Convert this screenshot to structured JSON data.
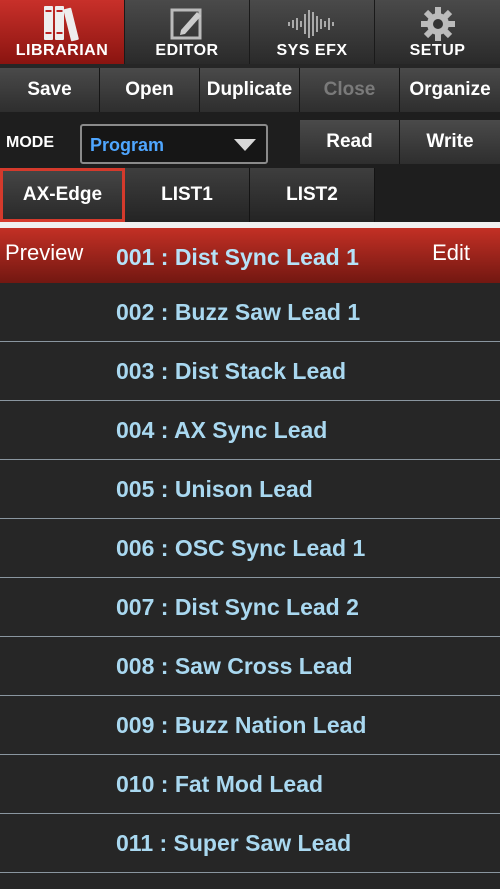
{
  "topnav": {
    "tabs": [
      {
        "label": "LIBRARIAN",
        "icon": "books-icon",
        "active": true
      },
      {
        "label": "EDITOR",
        "icon": "pencil-edit-icon",
        "active": false
      },
      {
        "label": "SYS EFX",
        "icon": "waveform-icon",
        "active": false
      },
      {
        "label": "SETUP",
        "icon": "gear-icon",
        "active": false
      }
    ]
  },
  "actions": {
    "save": "Save",
    "open": "Open",
    "duplicate": "Duplicate",
    "close": "Close",
    "organize": "Organize"
  },
  "mode": {
    "label": "MODE",
    "value": "Program",
    "read": "Read",
    "write": "Write"
  },
  "listtabs": [
    "AX-Edge",
    "LIST1",
    "LIST2"
  ],
  "list": {
    "preview_label": "Preview",
    "edit_label": "Edit",
    "items": [
      "001 : Dist Sync Lead 1",
      "002 : Buzz Saw Lead 1",
      "003 : Dist Stack Lead",
      "004 : AX Sync Lead",
      "005 : Unison Lead",
      "006 : OSC Sync Lead 1",
      "007 : Dist Sync Lead 2",
      "008 : Saw Cross Lead",
      "009 : Buzz Nation Lead",
      "010 : Fat Mod Lead",
      "011 : Super Saw Lead"
    ]
  },
  "colors": {
    "accent_red": "#c8302a",
    "item_text": "#a9d8f0",
    "mode_value": "#4fa6ff"
  }
}
